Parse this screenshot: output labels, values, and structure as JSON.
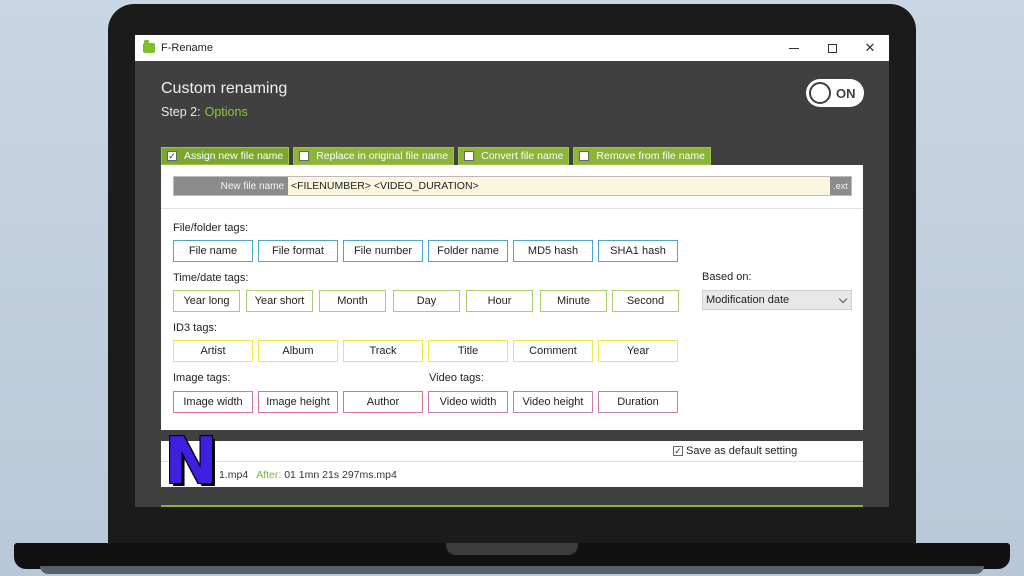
{
  "window": {
    "title": "F-Rename"
  },
  "header": {
    "title": "Custom renaming",
    "step_prefix": "Step 2:",
    "step_name": "Options",
    "toggle_label": "ON"
  },
  "tabs": [
    {
      "label": "Assign new file name",
      "checked": true
    },
    {
      "label": "Replace in original file name",
      "checked": false
    },
    {
      "label": "Convert file name",
      "checked": false
    },
    {
      "label": "Remove from file name",
      "checked": false
    }
  ],
  "new_name": {
    "label": "New file name",
    "value": "<FILENUMBER> <VIDEO_DURATION>",
    "ext": ".ext"
  },
  "sections": {
    "file_folder": {
      "label": "File/folder tags:",
      "tags": [
        "File name",
        "File format",
        "File number",
        "Folder name",
        "MD5 hash",
        "SHA1 hash"
      ]
    },
    "time_date": {
      "label": "Time/date tags:",
      "tags": [
        "Year long",
        "Year short",
        "Month",
        "Day",
        "Hour",
        "Minute",
        "Second"
      ]
    },
    "id3": {
      "label": "ID3 tags:",
      "tags": [
        "Artist",
        "Album",
        "Track",
        "Title",
        "Comment",
        "Year"
      ]
    },
    "image": {
      "label": "Image tags:",
      "tags": [
        "Image width",
        "Image height",
        "Author"
      ]
    },
    "video": {
      "label": "Video tags:",
      "tags": [
        "Video width",
        "Video height",
        "Duration"
      ]
    }
  },
  "based_on": {
    "label": "Based on:",
    "selected": "Modification date"
  },
  "bottom": {
    "save_default": "Save as default setting",
    "preview_before": "1.mp4",
    "after_label": "After:",
    "after_value": "01 1mn 21s 297ms.mp4"
  },
  "colors": {
    "accent_green": "#8cb33a",
    "file_tag_border": "#4aa6c8",
    "time_tag_border": "#a9cf6a",
    "id3_tag_border": "#f0e64a",
    "image_tag_border": "#d9748f",
    "video_tag_border": "#c07cb3",
    "logo": "#3f1fe0"
  },
  "icons": [
    "app-icon",
    "minimize-icon",
    "maximize-icon",
    "close-icon",
    "checkbox-icon",
    "chevron-down-icon"
  ]
}
